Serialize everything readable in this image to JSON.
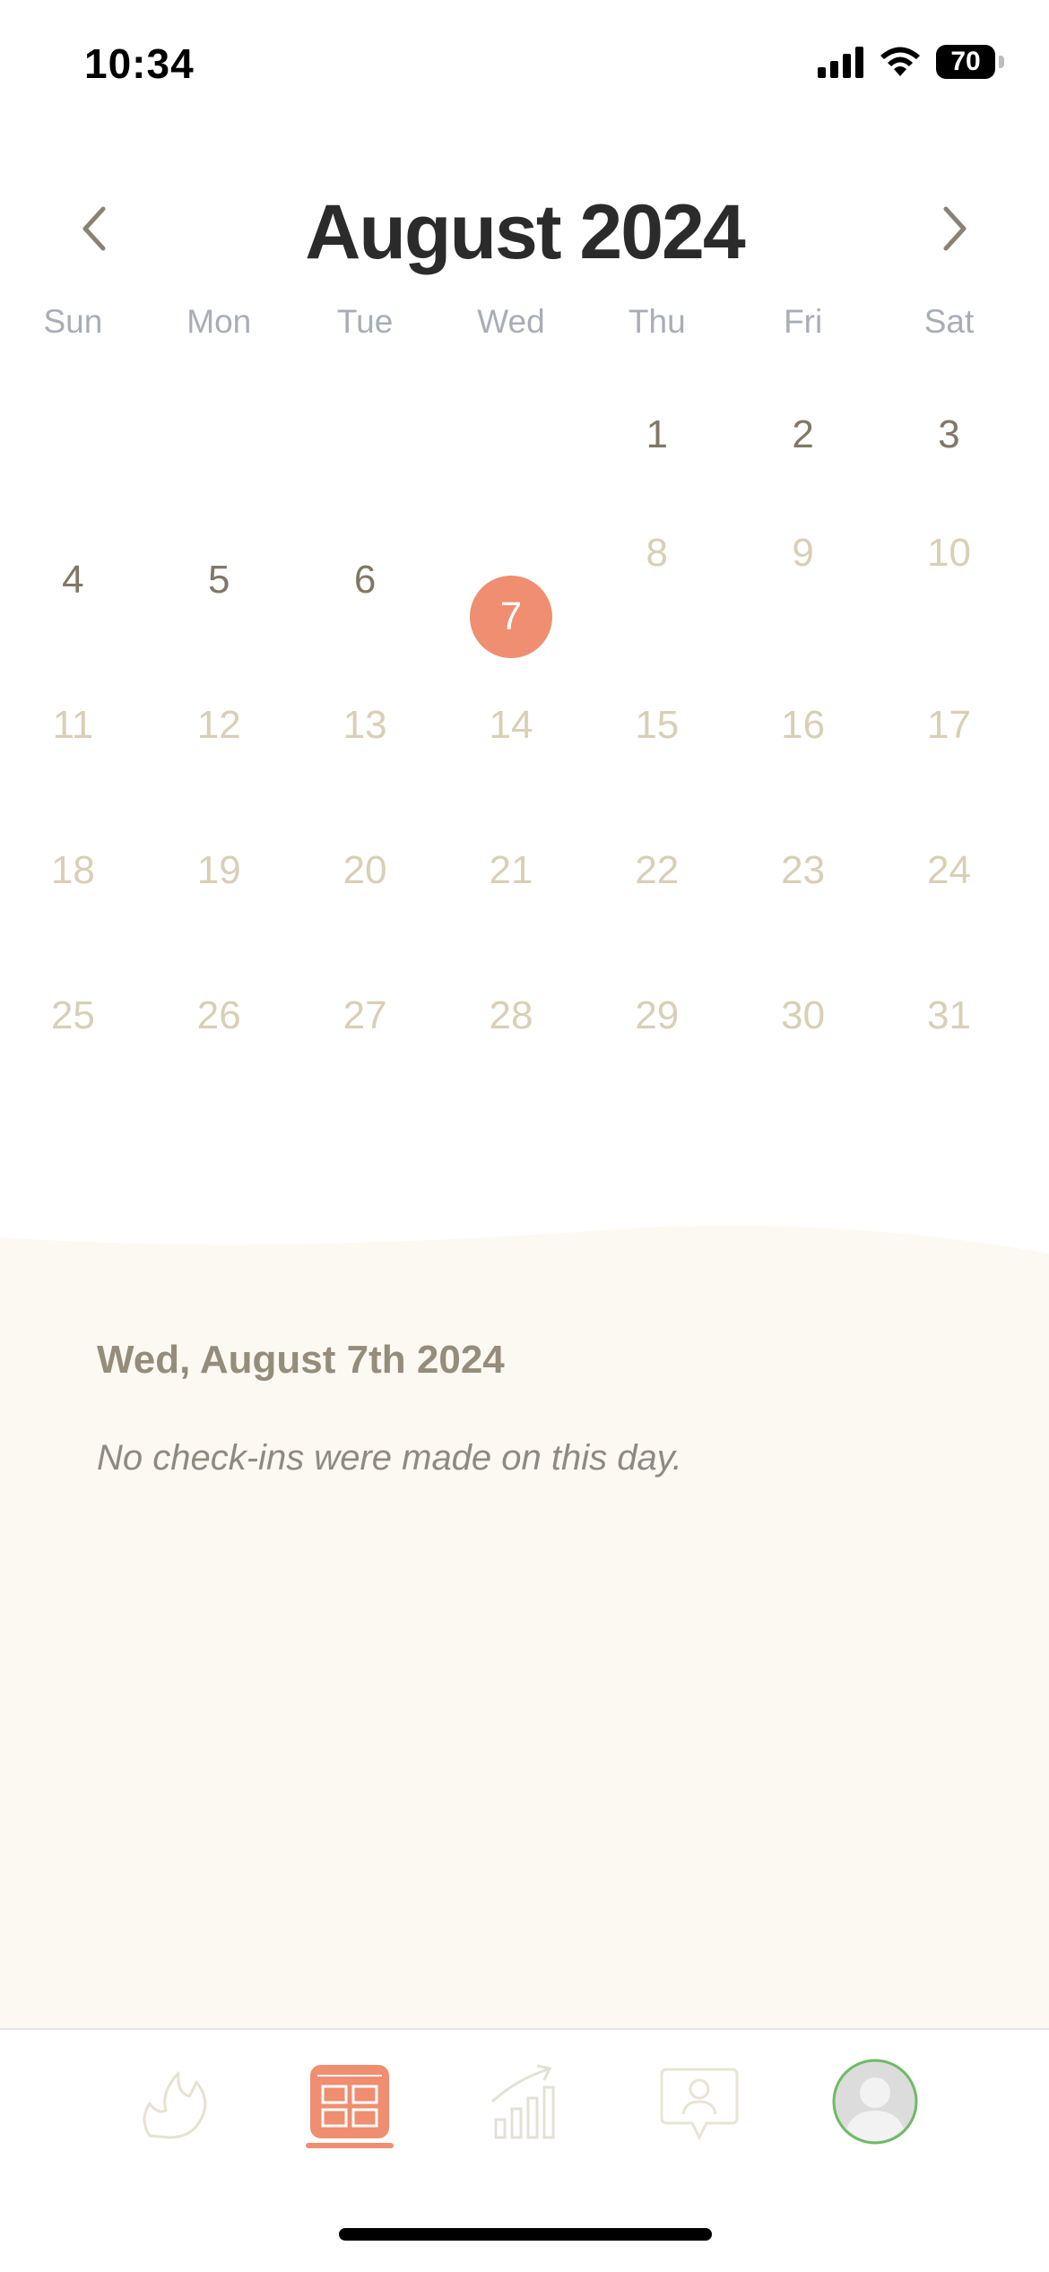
{
  "status_bar": {
    "time": "10:34",
    "battery": "70"
  },
  "calendar": {
    "title": "August 2024",
    "weekdays": [
      "Sun",
      "Mon",
      "Tue",
      "Wed",
      "Thu",
      "Fri",
      "Sat"
    ],
    "days": [
      "1",
      "2",
      "3",
      "4",
      "5",
      "6",
      "7",
      "8",
      "9",
      "10",
      "11",
      "12",
      "13",
      "14",
      "15",
      "16",
      "17",
      "18",
      "19",
      "20",
      "21",
      "22",
      "23",
      "24",
      "25",
      "26",
      "27",
      "28",
      "29",
      "30",
      "31"
    ],
    "selected_day": "7"
  },
  "detail": {
    "date": "Wed, August 7th 2024",
    "message": "No check-ins were made on this day."
  },
  "tabs": {
    "items": [
      "flame-icon",
      "calendar-grid-icon",
      "stats-chart-icon",
      "coach-chat-icon",
      "profile-avatar"
    ],
    "active": "calendar-grid-icon"
  },
  "colors": {
    "accent": "#ef8e70",
    "panel": "#fbf9f2",
    "muted_day": "#d8cfb6",
    "active_day": "#807865"
  }
}
